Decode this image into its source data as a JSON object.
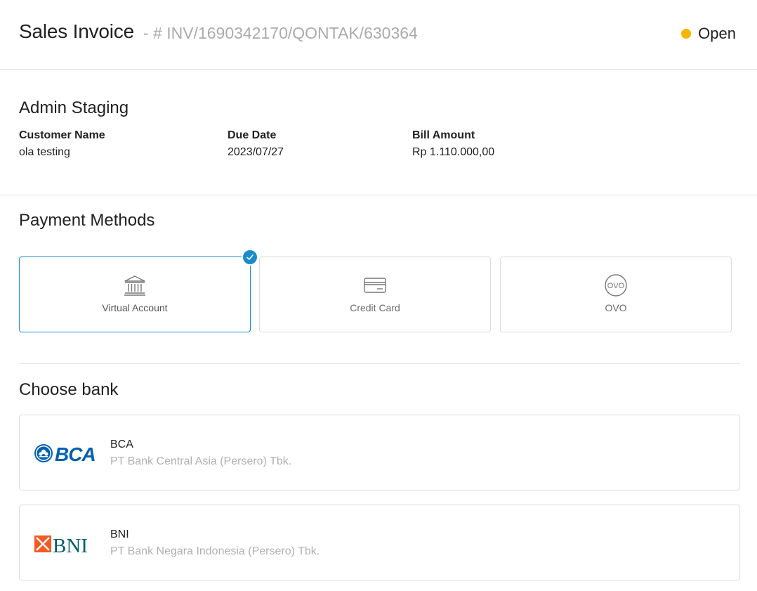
{
  "header": {
    "title": "Sales Invoice",
    "invoice_number": "- # INV/1690342170/QONTAK/630364",
    "status": {
      "label": "Open",
      "color": "#f7b500"
    }
  },
  "company": {
    "name": "Admin Staging"
  },
  "info": {
    "customer_label": "Customer Name",
    "customer_value": "ola testing",
    "due_label": "Due Date",
    "due_value": "2023/07/27",
    "amount_label": "Bill Amount",
    "amount_value": "Rp 1.110.000,00"
  },
  "payment_methods": {
    "title": "Payment Methods",
    "items": [
      {
        "label": "Virtual Account",
        "icon": "bank-building-icon",
        "selected": true
      },
      {
        "label": "Credit Card",
        "icon": "credit-card-icon",
        "selected": false
      },
      {
        "label": "OVO",
        "icon": "ovo-icon",
        "selected": false
      }
    ],
    "ovo_icon_text": "OVO"
  },
  "choose_bank": {
    "title": "Choose bank",
    "banks": [
      {
        "code": "BCA",
        "name": "PT Bank Central Asia (Persero) Tbk.",
        "logo": "bca-logo",
        "logo_text": "BCA"
      },
      {
        "code": "BNI",
        "name": "PT Bank Negara Indonesia (Persero) Tbk.",
        "logo": "bni-logo",
        "logo_text": "BNI"
      }
    ]
  },
  "colors": {
    "accent": "#1a8ccc",
    "status": "#f7b500",
    "bca_blue": "#0060af",
    "bni_orange": "#f15a23",
    "bni_teal": "#005e6a"
  }
}
